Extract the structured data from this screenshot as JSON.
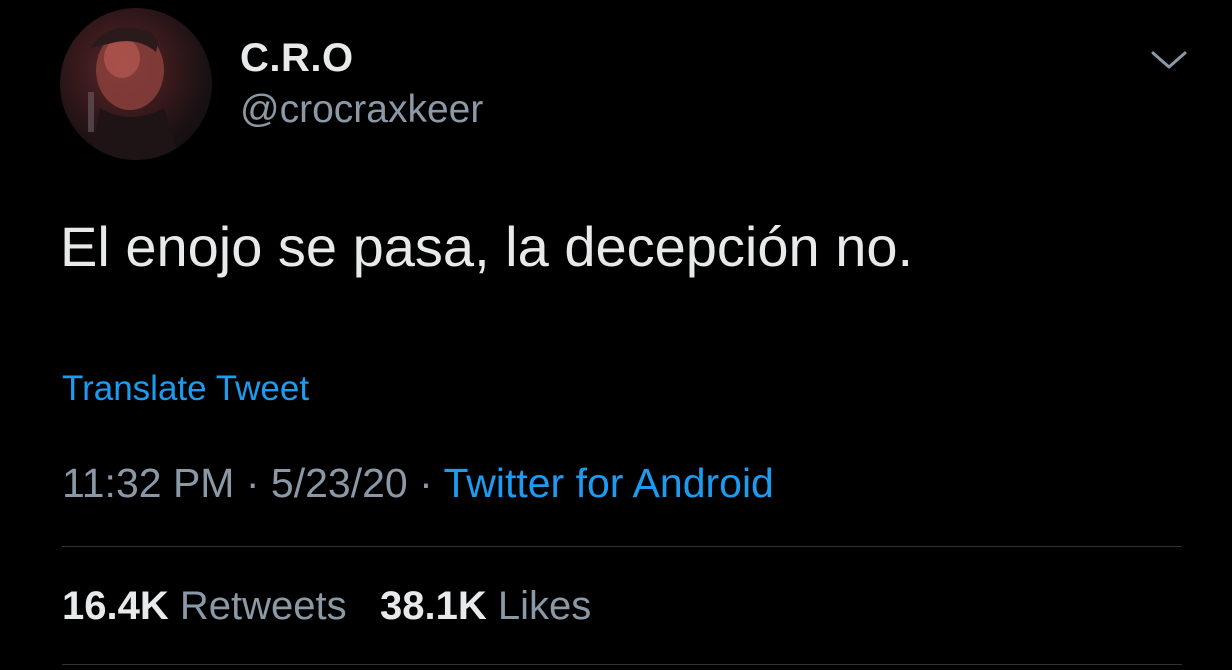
{
  "author": {
    "display_name": "C.R.O",
    "handle": "@crocraxkeer"
  },
  "tweet": {
    "text": "El enojo se pasa, la decepción no.",
    "translate_label": "Translate Tweet",
    "time": "11:32 PM",
    "separator": "·",
    "date": "5/23/20",
    "source": "Twitter for Android"
  },
  "stats": {
    "retweets_count": "16.4K",
    "retweets_label": "Retweets",
    "likes_count": "38.1K",
    "likes_label": "Likes"
  },
  "icons": {
    "menu": "chevron-down-icon"
  },
  "colors": {
    "background": "#000000",
    "primary_text": "#e7e9ea",
    "secondary_text": "#8b98a5",
    "link": "#1d9bf0",
    "divider": "#2f3336"
  }
}
